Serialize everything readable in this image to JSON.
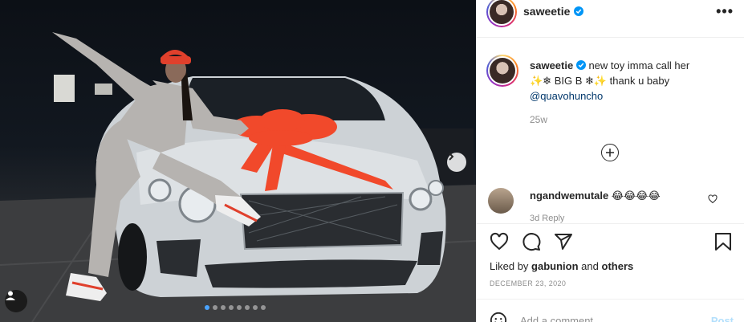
{
  "post": {
    "username": "saweetie",
    "caption": {
      "username": "saweetie",
      "line1": "new toy imma call her",
      "line2": "✨❄ BIG B ❄✨ thank u baby",
      "mention": "@quavohuncho",
      "time": "25w"
    },
    "comment": {
      "username": "ngandwemutale",
      "text": "😂😂😂😂",
      "meta": "3d   Reply"
    },
    "likes": {
      "prefix": "Liked by",
      "user": "gabunion",
      "and": "and",
      "others": "others"
    },
    "date": "DECEMBER 23, 2020",
    "add_comment_placeholder": "Add a comment...",
    "post_label": "Post",
    "more_label": "•••"
  },
  "media": {
    "carousel_count": 8,
    "carousel_active": 1
  },
  "colors": {
    "verified": "#0095f6",
    "mention": "#00376b",
    "post_disabled": "#b2dffc"
  }
}
